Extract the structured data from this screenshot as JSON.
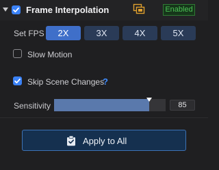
{
  "header": {
    "title": "Frame Interpolation",
    "enabled": true,
    "status_badge": "Enabled",
    "icons": {
      "disclosure": "disclosure-triangle-icon",
      "copy": "copy-icon"
    }
  },
  "fps": {
    "label": "Set FPS",
    "options": [
      "2X",
      "3X",
      "4X",
      "5X"
    ],
    "selected": "2X"
  },
  "slow_motion": {
    "label": "Slow Motion",
    "checked": false
  },
  "skip_scene_changes": {
    "label": "Skip Scene Changes",
    "checked": true,
    "help_symbol": "?"
  },
  "sensitivity": {
    "label": "Sensitivity",
    "value": "85",
    "value_num": 85,
    "max": 100
  },
  "apply": {
    "label": "Apply to All",
    "icon": "clipboard-check-icon"
  },
  "colors": {
    "accent": "#3b82f6",
    "enabled_green": "#4cc255",
    "selected_button": "#3f6fc9"
  }
}
